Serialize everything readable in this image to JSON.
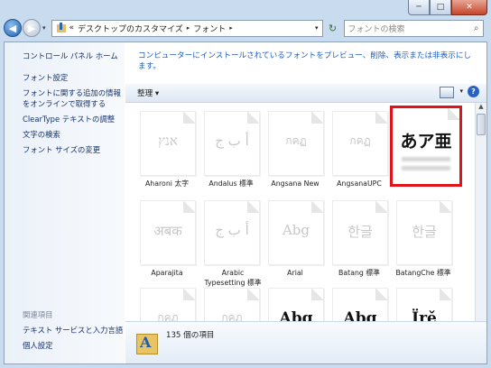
{
  "window": {
    "min_symbol": "─",
    "max_symbol": "□",
    "close_symbol": "✕"
  },
  "nav": {
    "back_symbol": "◀",
    "forward_symbol": "▶",
    "history_dropdown": "▾",
    "breadcrumb_overflow": "«",
    "breadcrumbs": [
      "デスクトップのカスタマイズ",
      "フォント"
    ],
    "crumb_sep": "▸",
    "address_dropdown": "▾",
    "refresh_symbol": "↻",
    "search_placeholder": "フォントの検索",
    "search_symbol": "⌕"
  },
  "sidebar": {
    "home": "コントロール パネル ホーム",
    "links": [
      "フォント設定",
      "フォントに関する追加の情報",
      "をオンラインで取得する",
      "ClearType テキストの調整",
      "文字の検索",
      "フォント サイズの変更"
    ],
    "related_header": "関連項目",
    "related": [
      "テキスト サービスと入力言語",
      "個人設定"
    ]
  },
  "main": {
    "description": "コンピューターにインストールされているフォントをプレビュー、削除、表示または非表示にします。",
    "organize_label": "整理 ▾",
    "view_dropdown": "▾",
    "help_symbol": "?"
  },
  "fonts": [
    {
      "name": "Aharoni 太字",
      "preview": "אנץ",
      "faded": true
    },
    {
      "name": "Andalus 標準",
      "preview": "أ ب ج",
      "faded": true
    },
    {
      "name": "Angsana New",
      "preview": "กคฏ",
      "faded": true
    },
    {
      "name": "AngsanaUPC",
      "preview": "กคฏ",
      "faded": true
    },
    {
      "name": "",
      "preview": "あア亜",
      "faded": false,
      "selected": true
    },
    {
      "name": "Aparajita",
      "preview": "अबक",
      "faded": true
    },
    {
      "name": "Arabic Typesetting 標準",
      "preview": "أ ب ج",
      "faded": true
    },
    {
      "name": "Arial",
      "preview": "Abg",
      "faded": true
    },
    {
      "name": "Batang 標準",
      "preview": "한글",
      "faded": true
    },
    {
      "name": "BatangChe 標準",
      "preview": "한글",
      "faded": true
    },
    {
      "name": "",
      "preview": "กคฏ",
      "faded": true
    },
    {
      "name": "",
      "preview": "กคฏ",
      "faded": true
    },
    {
      "name": "",
      "preview": "Abg",
      "faded": false
    },
    {
      "name": "",
      "preview": "Abg",
      "faded": false
    },
    {
      "name": "",
      "preview": "Ïrě",
      "faded": false
    }
  ],
  "status": {
    "count": "135 個の項目"
  }
}
